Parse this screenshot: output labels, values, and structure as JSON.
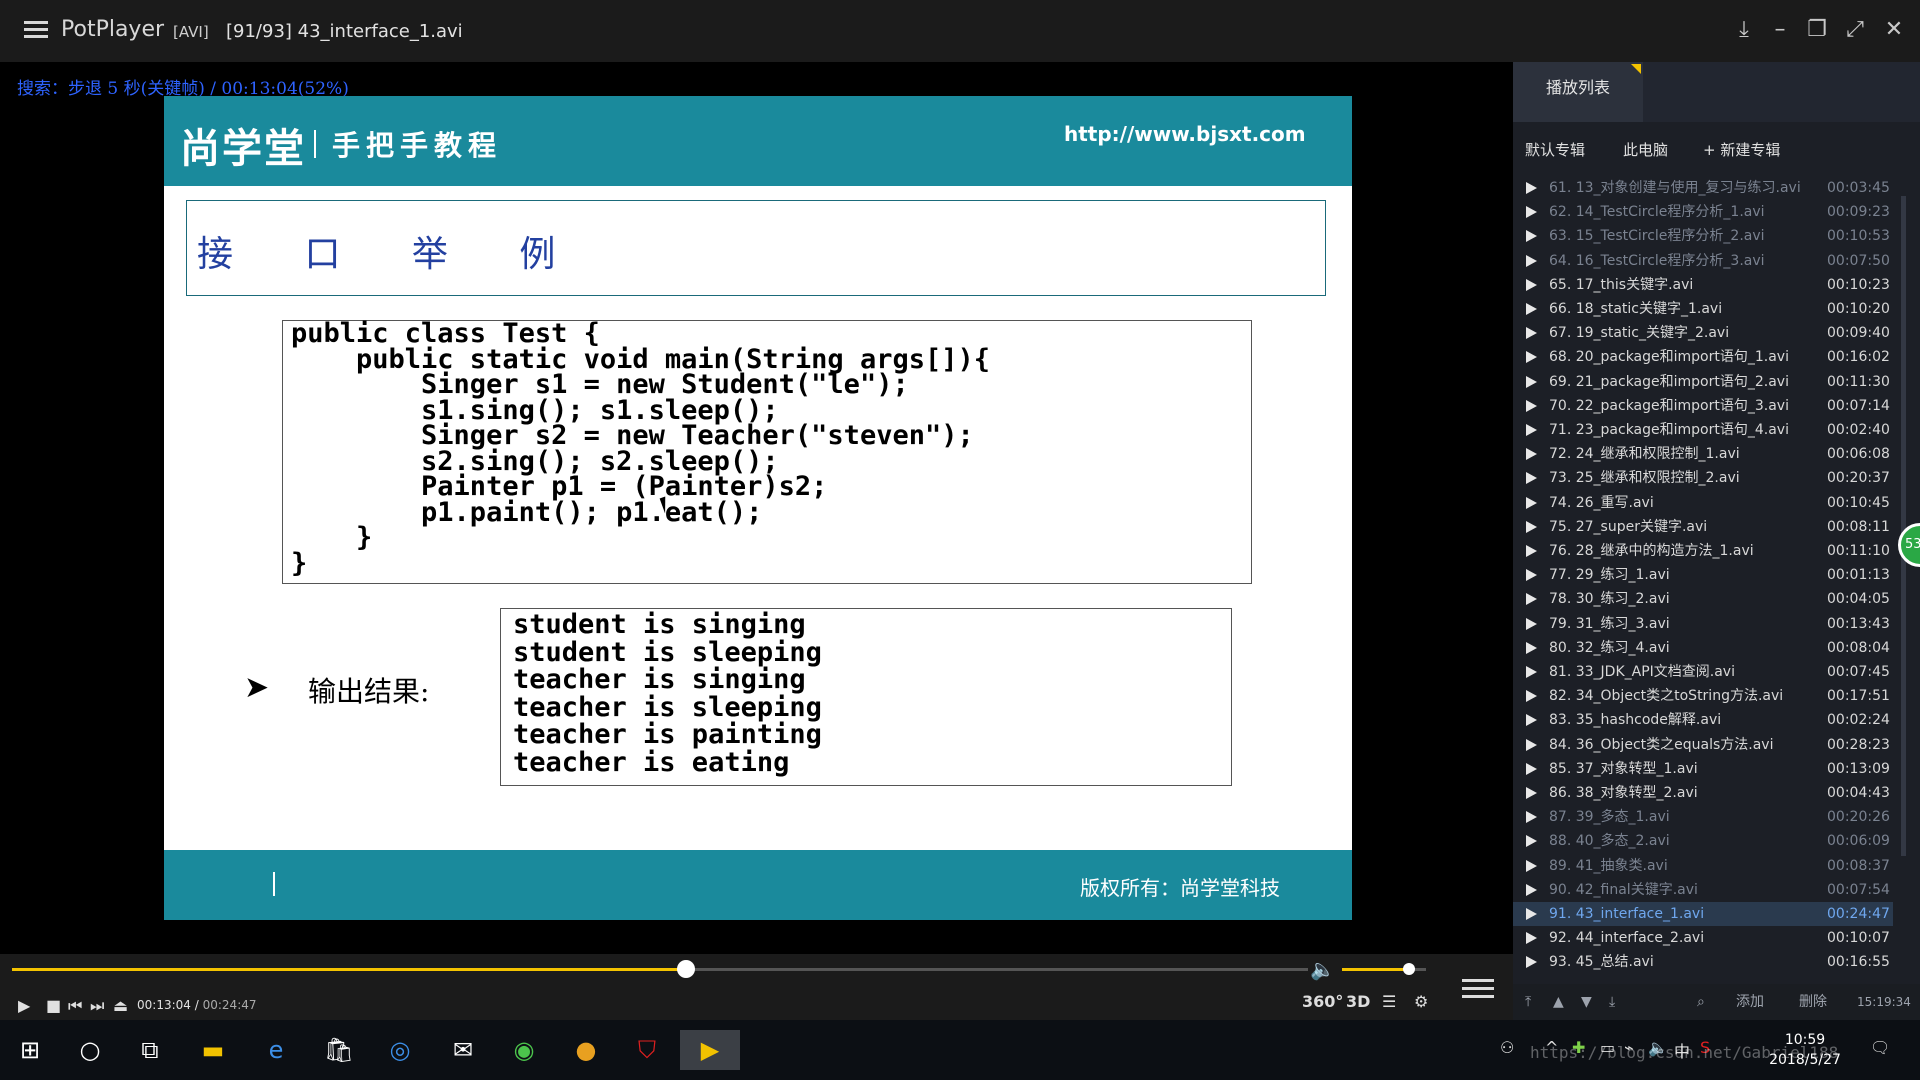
{
  "titlebar": {
    "app": "PotPlayer",
    "format": "[AVI]",
    "file": "[91/93] 43_interface_1.avi"
  },
  "osd": "搜索：步退 5 秒(关键帧) / 00:13:04(52%)",
  "slide": {
    "logo": "尚学堂",
    "slogan": "手把手教程",
    "url": "http://www.bjsxt.com",
    "title": "接 口 举 例",
    "code": [
      "public class Test {",
      "    public static void main(String args[]){",
      "        Singer s1 = new Student(\"le\");",
      "        s1.sing(); s1.sleep();",
      "        Singer s2 = new Teacher(\"steven\");",
      "        s2.sing(); s2.sleep();",
      "        Painter p1 = (Painter)s2;",
      "        p1.paint(); p1.eat();",
      "    }",
      "}"
    ],
    "output_label": "输出结果:",
    "output": [
      "student is singing",
      "student is sleeping",
      "teacher is singing",
      "teacher is sleeping",
      "teacher is painting",
      "teacher is eating"
    ],
    "copyright": "版权所有：尚学堂科技"
  },
  "playlist": {
    "tab": "播放列表",
    "subtabs": [
      "默认专辑",
      "此电脑",
      "+ 新建专辑"
    ],
    "items": [
      {
        "name": "61. 13_对象创建与使用_复习与练习.avi",
        "time": "00:03:45",
        "dim": true
      },
      {
        "name": "62. 14_TestCircle程序分析_1.avi",
        "time": "00:09:23",
        "dim": true
      },
      {
        "name": "63. 15_TestCircle程序分析_2.avi",
        "time": "00:10:53",
        "dim": true
      },
      {
        "name": "64. 16_TestCircle程序分析_3.avi",
        "time": "00:07:50",
        "dim": true
      },
      {
        "name": "65. 17_this关键字.avi",
        "time": "00:10:23",
        "dim": false
      },
      {
        "name": "66. 18_static关键字_1.avi",
        "time": "00:10:20",
        "dim": false
      },
      {
        "name": "67. 19_static_关键字_2.avi",
        "time": "00:09:40",
        "dim": false
      },
      {
        "name": "68. 20_package和import语句_1.avi",
        "time": "00:16:02",
        "dim": false
      },
      {
        "name": "69. 21_package和import语句_2.avi",
        "time": "00:11:30",
        "dim": false
      },
      {
        "name": "70. 22_package和import语句_3.avi",
        "time": "00:07:14",
        "dim": false
      },
      {
        "name": "71. 23_package和import语句_4.avi",
        "time": "00:02:40",
        "dim": false
      },
      {
        "name": "72. 24_继承和权限控制_1.avi",
        "time": "00:06:08",
        "dim": false
      },
      {
        "name": "73. 25_继承和权限控制_2.avi",
        "time": "00:20:37",
        "dim": false
      },
      {
        "name": "74. 26_重写.avi",
        "time": "00:10:45",
        "dim": false
      },
      {
        "name": "75. 27_super关键字.avi",
        "time": "00:08:11",
        "dim": false
      },
      {
        "name": "76. 28_继承中的构造方法_1.avi",
        "time": "00:11:10",
        "dim": false
      },
      {
        "name": "77. 29_练习_1.avi",
        "time": "00:01:13",
        "dim": false
      },
      {
        "name": "78. 30_练习_2.avi",
        "time": "00:04:05",
        "dim": false
      },
      {
        "name": "79. 31_练习_3.avi",
        "time": "00:13:43",
        "dim": false
      },
      {
        "name": "80. 32_练习_4.avi",
        "time": "00:08:04",
        "dim": false
      },
      {
        "name": "81. 33_JDK_API文档查阅.avi",
        "time": "00:07:45",
        "dim": false
      },
      {
        "name": "82. 34_Object类之toString方法.avi",
        "time": "00:17:51",
        "dim": false
      },
      {
        "name": "83. 35_hashcode解释.avi",
        "time": "00:02:24",
        "dim": false
      },
      {
        "name": "84. 36_Object类之equals方法.avi",
        "time": "00:28:23",
        "dim": false
      },
      {
        "name": "85. 37_对象转型_1.avi",
        "time": "00:13:09",
        "dim": false
      },
      {
        "name": "86. 38_对象转型_2.avi",
        "time": "00:04:43",
        "dim": false
      },
      {
        "name": "87. 39_多态_1.avi",
        "time": "00:20:26",
        "dim": true
      },
      {
        "name": "88. 40_多态_2.avi",
        "time": "00:06:09",
        "dim": true
      },
      {
        "name": "89. 41_抽象类.avi",
        "time": "00:08:37",
        "dim": true
      },
      {
        "name": "90. 42_final关键字.avi",
        "time": "00:07:54",
        "dim": true
      },
      {
        "name": "91. 43_interface_1.avi",
        "time": "00:24:47",
        "dim": false,
        "current": true
      },
      {
        "name": "92. 44_interface_2.avi",
        "time": "00:10:07",
        "dim": false
      },
      {
        "name": "93. 45_总结.avi",
        "time": "00:16:55",
        "dim": false
      }
    ],
    "bottom": {
      "add": "添加",
      "delete": "删除",
      "clock": "15:19:34"
    }
  },
  "controls": {
    "elapsed": "00:13:04",
    "separator": "/",
    "total": "00:24:47",
    "progress_fraction": 0.52,
    "volume_fraction": 0.8,
    "b360": "360°",
    "b3d": "3D"
  },
  "taskbar": {
    "time": "10:59",
    "date": "2018/5/27",
    "ime": "中",
    "watermark": "https://blog.csdn.net/Gabriel188"
  },
  "bubble": "53",
  "colors": {
    "teal": "#1a8a9c",
    "accent": "#f4c300",
    "osd_blue": "#2e63ff",
    "current_item": "#6fa7ee"
  }
}
